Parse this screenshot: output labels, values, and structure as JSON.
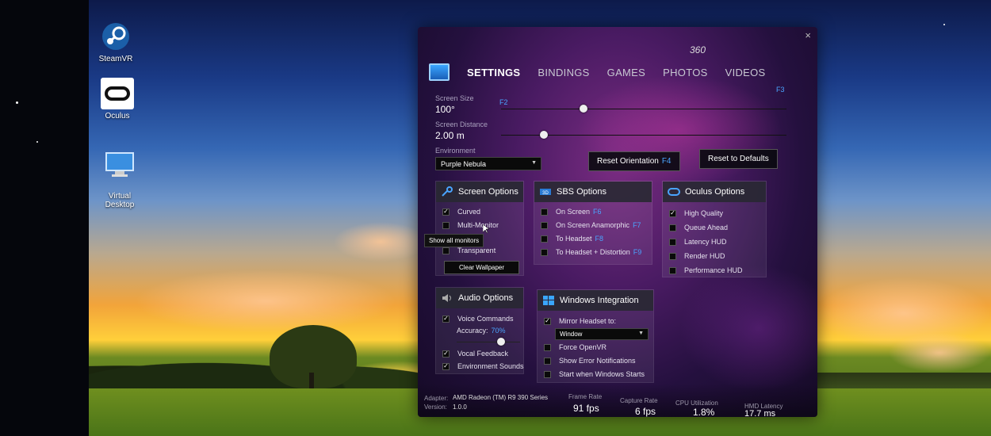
{
  "desktop": {
    "icons": [
      {
        "label": "SteamVR",
        "icon": "steamvr-icon"
      },
      {
        "label": "Oculus",
        "icon": "oculus-icon"
      },
      {
        "label": "Virtual\nDesktop",
        "icon": "monitor-icon"
      }
    ]
  },
  "panel": {
    "close": "×",
    "tabs": {
      "settings": "SETTINGS",
      "bindings": "BINDINGS",
      "games": "GAMES",
      "photos": "PHOTOS",
      "photos360": "360",
      "videos": "VIDEOS"
    },
    "screen_size": {
      "label": "Screen Size",
      "value": "100°",
      "key_left": "F2",
      "key_right": "F3",
      "level": 0.29
    },
    "screen_distance": {
      "label": "Screen Distance",
      "value": "2.00 m",
      "level": 0.15
    },
    "environment": {
      "label": "Environment",
      "value": "Purple Nebula"
    },
    "reset_orientation": {
      "label": "Reset Orientation",
      "key": "F4"
    },
    "reset_defaults": "Reset to Defaults",
    "screen_options": {
      "title": "Screen Options",
      "curved": "Curved",
      "multi_monitor": "Multi-Monitor",
      "tooltip": "Show all monitors",
      "transparent": "Transparent",
      "clear_wallpaper": "Clear Wallpaper"
    },
    "sbs_options": {
      "title": "SBS Options",
      "items": [
        {
          "label": "On Screen",
          "key": "F6"
        },
        {
          "label": "On Screen Anamorphic",
          "key": "F7"
        },
        {
          "label": "To Headset",
          "key": "F8"
        },
        {
          "label": "To Headset + Distortion",
          "key": "F9"
        }
      ]
    },
    "oculus_options": {
      "title": "Oculus Options",
      "high_quality": "High Quality",
      "queue_ahead": "Queue Ahead",
      "latency_hud": "Latency HUD",
      "render_hud": "Render HUD",
      "performance_hud": "Performance HUD"
    },
    "audio_options": {
      "title": "Audio Options",
      "voice_commands": "Voice Commands",
      "accuracy_label": "Accuracy:",
      "accuracy_value": "70%",
      "vocal_feedback": "Vocal Feedback",
      "environment_sounds": "Environment Sounds",
      "accuracy_level": 0.7
    },
    "windows_integration": {
      "title": "Windows Integration",
      "mirror_label": "Mirror Headset to:",
      "mirror_value": "Window",
      "force_openvr": "Force OpenVR",
      "show_errors": "Show Error Notifications",
      "start_with_windows": "Start when Windows Starts"
    },
    "status": {
      "adapter_label": "Adapter:",
      "adapter_value": "AMD Radeon (TM) R9 390 Series",
      "version_label": "Version:",
      "version_value": "1.0.0",
      "frame_rate_label": "Frame Rate",
      "frame_rate": "91 fps",
      "capture_rate_label": "Capture Rate",
      "capture_rate": "6 fps",
      "cpu_label": "CPU Utilization",
      "cpu": "1.8%",
      "hmd_label": "HMD Latency",
      "hmd": "17.7 ms"
    }
  },
  "colors": {
    "accent": "#4aa4ff",
    "panel": "#4a1b63"
  }
}
